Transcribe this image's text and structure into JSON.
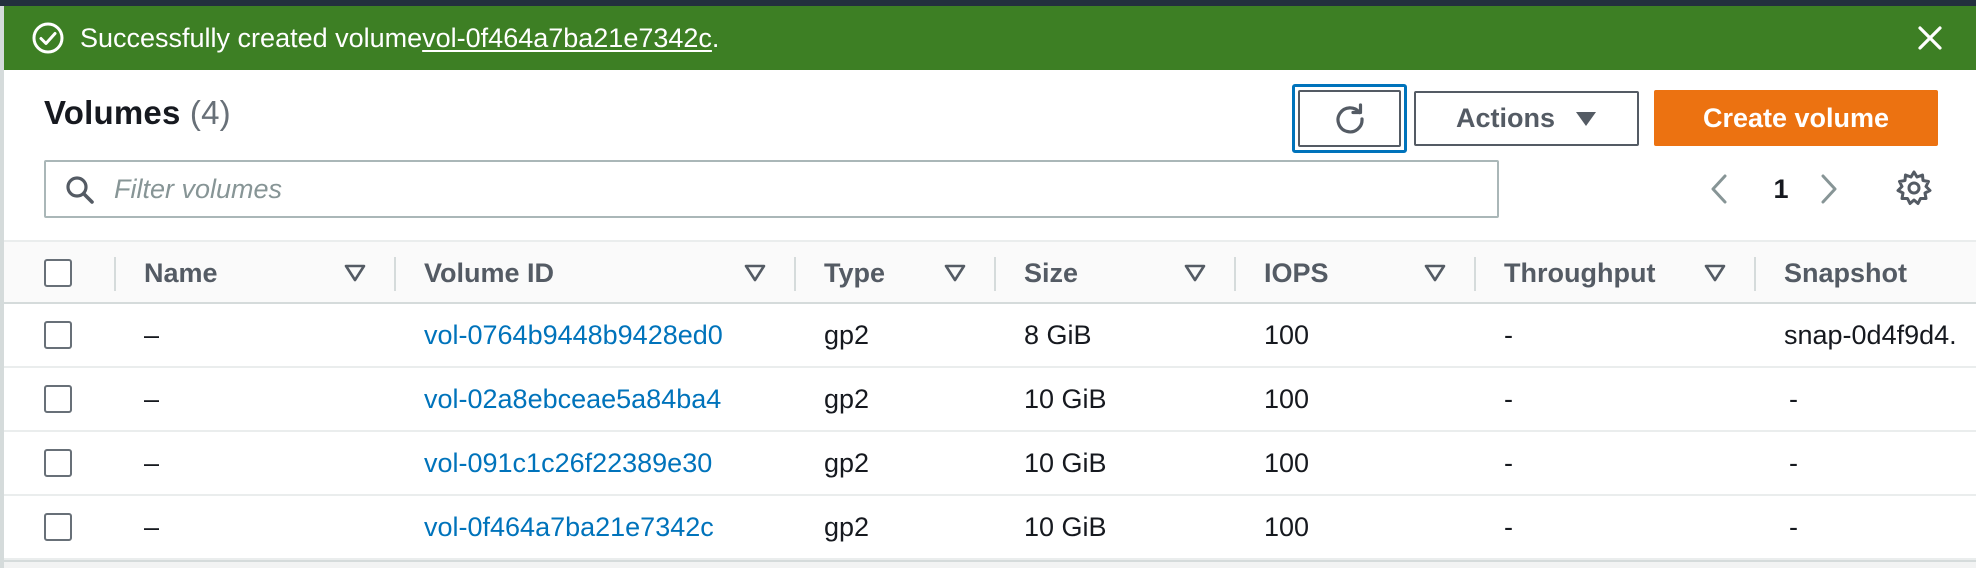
{
  "flash": {
    "message_prefix": "Successfully created volume ",
    "volume_link": "vol-0f464a7ba21e7342c",
    "message_suffix": ".",
    "type": "success",
    "status_icon": "check-circle-icon",
    "close_icon": "close-icon",
    "color": "#3d7f24"
  },
  "header": {
    "title": "Volumes",
    "count": "(4)",
    "refresh_icon": "refresh-icon",
    "actions_label": "Actions",
    "create_label": "Create volume",
    "create_color": "#ec7211"
  },
  "filter": {
    "placeholder": "Filter volumes",
    "value": ""
  },
  "pagination": {
    "current_page": "1"
  },
  "table": {
    "columns": [
      "Name",
      "Volume ID",
      "Type",
      "Size",
      "IOPS",
      "Throughput",
      "Snapshot"
    ],
    "rows": [
      {
        "name": "–",
        "volume_id": "vol-0764b9448b9428ed0",
        "type": "gp2",
        "size": "8 GiB",
        "iops": "100",
        "throughput": "-",
        "snapshot": "snap-0d4f9d4."
      },
      {
        "name": "–",
        "volume_id": "vol-02a8ebceae5a84ba4",
        "type": "gp2",
        "size": "10 GiB",
        "iops": "100",
        "throughput": "-",
        "snapshot": "-"
      },
      {
        "name": "–",
        "volume_id": "vol-091c1c26f22389e30",
        "type": "gp2",
        "size": "10 GiB",
        "iops": "100",
        "throughput": "-",
        "snapshot": "-"
      },
      {
        "name": "–",
        "volume_id": "vol-0f464a7ba21e7342c",
        "type": "gp2",
        "size": "10 GiB",
        "iops": "100",
        "throughput": "-",
        "snapshot": "-"
      }
    ]
  }
}
